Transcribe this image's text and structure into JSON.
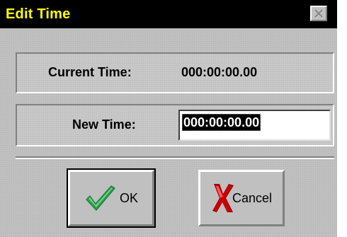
{
  "window": {
    "title": "Edit Time",
    "title_color": "#ffff00",
    "titlebar_color": "#000000"
  },
  "current_time": {
    "label": "Current Time:",
    "value": "000:00:00.00"
  },
  "new_time": {
    "label": "New Time:",
    "value": "000:00:00.00"
  },
  "buttons": {
    "ok_label": "OK",
    "ok_icon": "checkmark-icon",
    "cancel_label": "Cancel",
    "cancel_icon": "x-mark-icon"
  },
  "colors": {
    "checkmark": "#2a9d4a",
    "cancel_x": "#cc0000"
  }
}
